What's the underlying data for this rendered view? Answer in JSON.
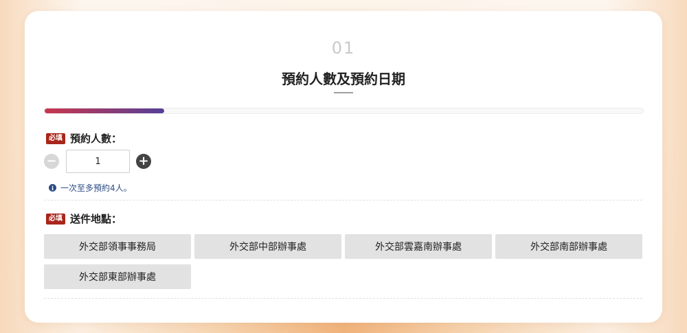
{
  "step": {
    "number": "01",
    "title": "預約人數及預約日期"
  },
  "progress": {
    "fraction": 0.2
  },
  "party_size": {
    "badge": "必填",
    "label": "預約人數：",
    "value": "1",
    "minus_icon": "minus-circle-icon",
    "plus_icon": "plus-circle-icon",
    "note": "一次至多預約4人。"
  },
  "delivery": {
    "badge": "必填",
    "label": "送件地點：",
    "options": [
      "外交部領事事務局",
      "外交部中部辦事處",
      "外交部雲嘉南辦事處",
      "外交部南部辦事處",
      "外交部東部辦事處"
    ]
  },
  "colors": {
    "badge": "#a8261c",
    "progress_start": "#c9364d",
    "progress_end": "#553f98",
    "info": "#2d4d86"
  }
}
